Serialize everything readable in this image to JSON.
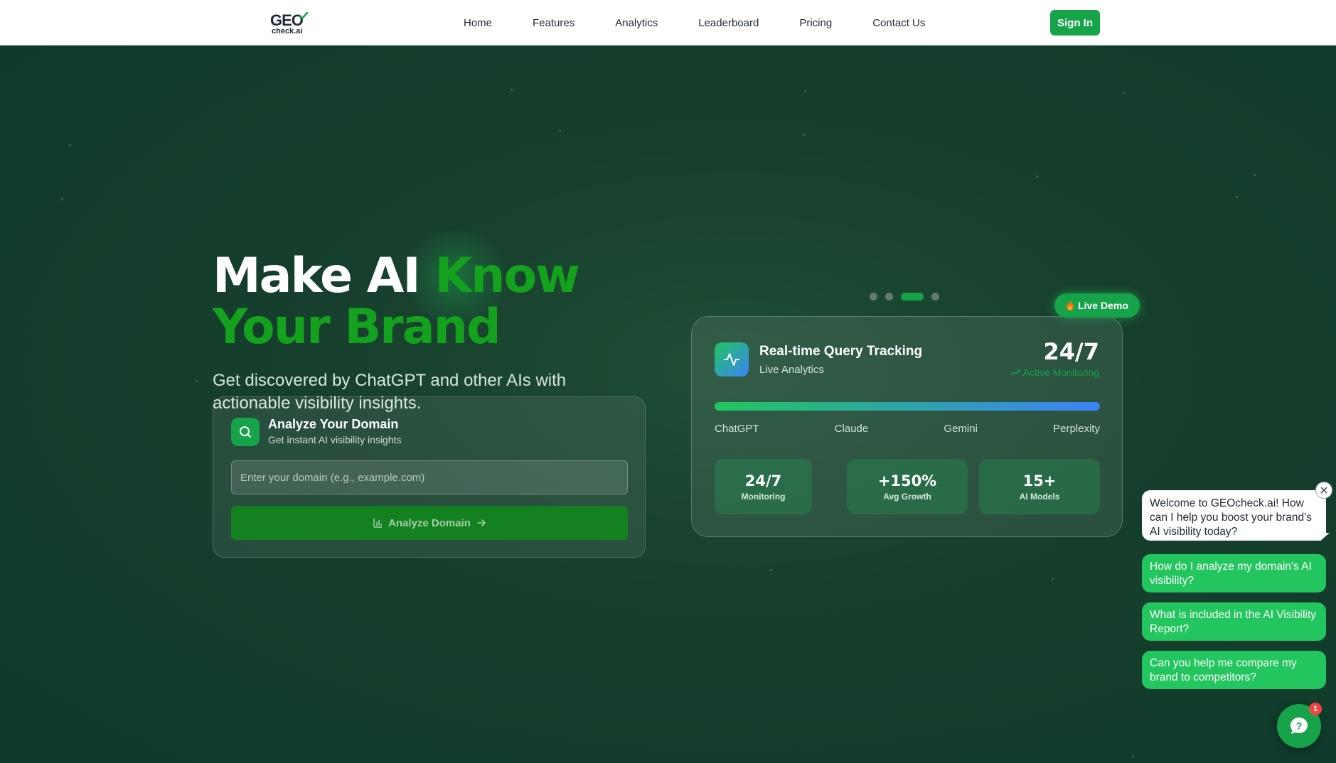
{
  "nav": {
    "logo_main": "GEO",
    "logo_sub": "check.ai",
    "links": [
      "Home",
      "Features",
      "Analytics",
      "Leaderboard",
      "Pricing",
      "Contact Us"
    ],
    "signin_label": "Sign In"
  },
  "hero": {
    "headline_white": "Make AI ",
    "headline_green1": "Know",
    "headline_green2": "Your Brand",
    "subheadline": "Get discovered by ChatGPT and other AIs with actionable visibility insights."
  },
  "analyze": {
    "title": "Analyze Your Domain",
    "subtitle": "Get instant AI visibility insights",
    "placeholder": "Enter your domain (e.g., example.com)",
    "button_label": "Analyze Domain",
    "icon": "search-icon"
  },
  "carousel": {
    "count": 4,
    "active_index": 2
  },
  "demo": {
    "badge": "Live Demo",
    "badge_icon": "fire-icon",
    "title": "Real-time Query Tracking",
    "subtitle": "Live Analytics",
    "big_value": "24/7",
    "active_label": "Active Monitoring",
    "progress_fraction": 1.0,
    "models": [
      "ChatGPT",
      "Claude",
      "Gemini",
      "Perplexity"
    ],
    "stats": [
      {
        "value": "24/7",
        "label": "Monitoring"
      },
      {
        "value": "+150%",
        "label": "Avg Growth"
      },
      {
        "value": "15+",
        "label": "AI Models"
      }
    ]
  },
  "chat": {
    "welcome": "Welcome to GEOcheck.ai! How can I help you boost your brand's AI visibility today?",
    "questions": [
      "How do I analyze my domain's AI visibility?",
      "What is included in the AI Visibility Report?",
      "Can you help me compare my brand to competitors?"
    ],
    "badge_count": "1"
  },
  "colors": {
    "accent": "#16a34a",
    "chat_bubble": "#22c55e",
    "hero_bg": "#0f3d2e",
    "notification": "#ef4444"
  }
}
